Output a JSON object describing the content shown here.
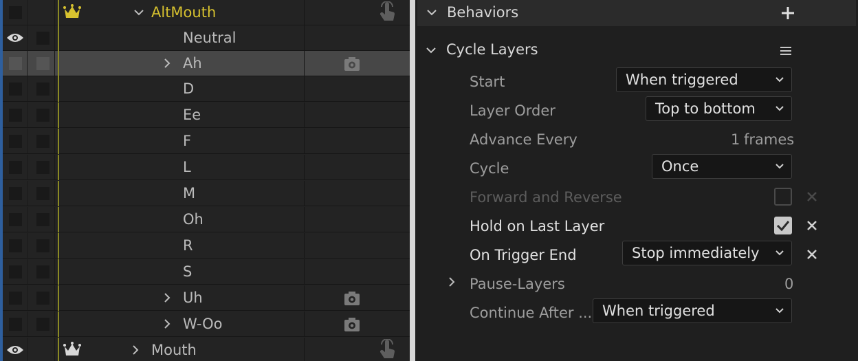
{
  "timeline": {
    "group_top": "AltMouth",
    "neutral": "Neutral",
    "rows": [
      "Ah",
      "D",
      "Ee",
      "F",
      "L",
      "M",
      "Oh",
      "R",
      "S",
      "Uh",
      "W-Oo"
    ],
    "group_bottom": "Mouth"
  },
  "behaviors": {
    "title": "Behaviors",
    "section": "Cycle Layers",
    "start_label": "Start",
    "start_value": "When triggered",
    "layer_order_label": "Layer Order",
    "layer_order_value": "Top to bottom",
    "advance_label": "Advance Every",
    "advance_value": "1",
    "advance_unit": "frames",
    "cycle_label": "Cycle",
    "cycle_value": "Once",
    "forward_label": "Forward and Reverse",
    "forward_checked": false,
    "hold_label": "Hold on Last Layer",
    "hold_checked": true,
    "trigger_end_label": "On Trigger End",
    "trigger_end_value": "Stop immediately",
    "pause_label": "Pause-Layers",
    "pause_value": "0",
    "continue_label": "Continue After ...",
    "continue_value": "When triggered"
  },
  "colors": {
    "group_label": "#d7c22f",
    "accent_blue": "#2d8ceb",
    "selected_row": "#474747"
  }
}
